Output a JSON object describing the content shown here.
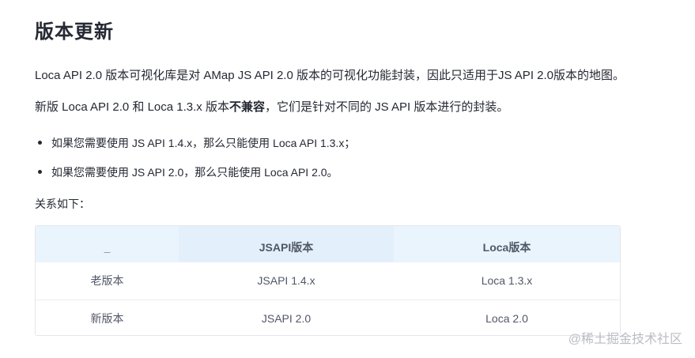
{
  "heading": "版本更新",
  "paragraphs": {
    "p1": "Loca API 2.0 版本可视化库是对 AMap JS API 2.0 版本的可视化功能封装，因此只适用于JS API 2.0版本的地图。",
    "p2_before": "新版 Loca API 2.0 和 Loca 1.3.x 版本",
    "p2_bold": "不兼容",
    "p2_after": "，它们是针对不同的 JS API 版本进行的封装。",
    "p3": "关系如下："
  },
  "bullets": [
    "如果您需要使用 JS API 1.4.x，那么只能使用 Loca API 1.3.x；",
    "如果您需要使用 JS API 2.0，那么只能使用 Loca API 2.0。"
  ],
  "table": {
    "headers": [
      "_",
      "JSAPI版本",
      "Loca版本"
    ],
    "rows": [
      [
        "老版本",
        "JSAPI 1.4.x",
        "Loca 1.3.x"
      ],
      [
        "新版本",
        "JSAPI 2.0",
        "Loca 2.0"
      ]
    ]
  },
  "watermark": "@稀土掘金技术社区"
}
